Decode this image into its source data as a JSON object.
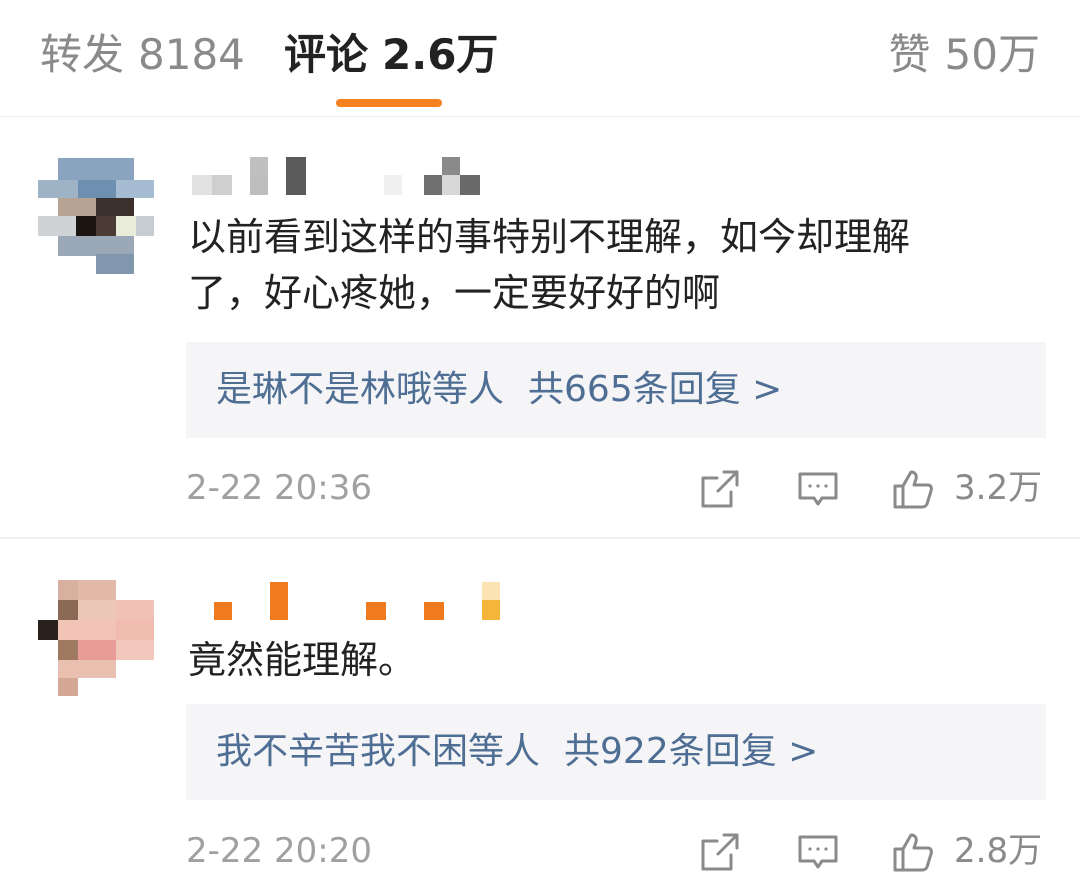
{
  "tabs": {
    "repost": {
      "label": "转发",
      "count": "8184"
    },
    "comments": {
      "label": "评论",
      "count": "2.6万"
    },
    "likes": {
      "label": "赞",
      "count": "50万"
    }
  },
  "colors": {
    "accent": "#f5821f",
    "link": "#4f6e94",
    "muted": "#a0a0a0"
  },
  "comments": [
    {
      "text_line1": "以前看到这样的事特别不理解，如今却理解",
      "text_line2": "了，好心疼她，一定要好好的啊",
      "replies": {
        "users": "是琳不是林哦等人",
        "summary": "共665条回复 >"
      },
      "time": "2-22 20:36",
      "likes": "3.2万",
      "icons": [
        "share-icon",
        "comment-icon",
        "thumbs-up-icon"
      ]
    },
    {
      "text_line1": "竟然能理解。",
      "replies": {
        "users": "我不辛苦我不困等人",
        "summary": "共922条回复 >"
      },
      "time": "2-22 20:20",
      "likes": "2.8万",
      "icons": [
        "share-icon",
        "comment-icon",
        "thumbs-up-icon"
      ]
    }
  ]
}
